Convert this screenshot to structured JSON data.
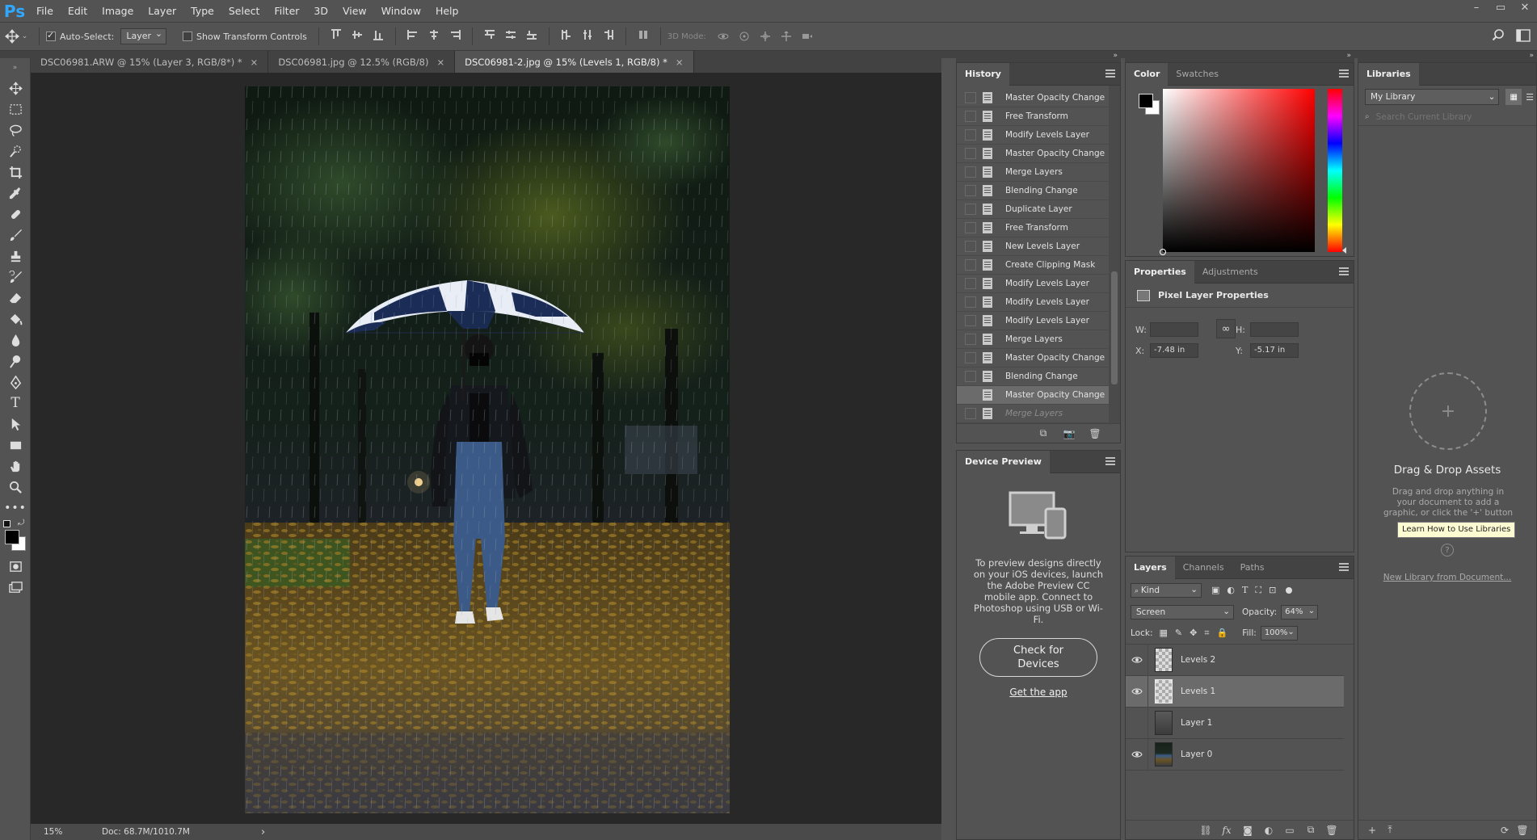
{
  "app": {
    "logo": "Ps"
  },
  "menu": [
    "File",
    "Edit",
    "Image",
    "Layer",
    "Type",
    "Select",
    "Filter",
    "3D",
    "View",
    "Window",
    "Help"
  ],
  "window_controls": [
    "–",
    "▭",
    "✕"
  ],
  "options_bar": {
    "auto_select_label": "Auto-Select:",
    "auto_select_checked": true,
    "auto_select_value": "Layer",
    "show_transform_label": "Show Transform Controls",
    "mode_3d_label": "3D Mode:"
  },
  "doc_tabs": [
    {
      "title": "DSC06981.ARW @ 15% (Layer 3, RGB/8*) *",
      "active": false
    },
    {
      "title": "DSC06981.jpg @ 12.5% (RGB/8)",
      "active": false
    },
    {
      "title": "DSC06981-2.jpg @ 15% (Levels 1, RGB/8) *",
      "active": true
    }
  ],
  "status": {
    "zoom": "15%",
    "doc": "Doc: 68.7M/1010.7M",
    "arrow": "›"
  },
  "history": {
    "title": "History",
    "items": [
      {
        "label": "Master Opacity Change",
        "state": "normal"
      },
      {
        "label": "Free Transform",
        "state": "normal"
      },
      {
        "label": "Modify Levels Layer",
        "state": "normal"
      },
      {
        "label": "Master Opacity Change",
        "state": "normal"
      },
      {
        "label": "Merge Layers",
        "state": "normal"
      },
      {
        "label": "Blending Change",
        "state": "normal"
      },
      {
        "label": "Duplicate Layer",
        "state": "normal"
      },
      {
        "label": "Free Transform",
        "state": "normal"
      },
      {
        "label": "New Levels Layer",
        "state": "normal"
      },
      {
        "label": "Create Clipping Mask",
        "state": "normal"
      },
      {
        "label": "Modify Levels Layer",
        "state": "normal"
      },
      {
        "label": "Modify Levels Layer",
        "state": "normal"
      },
      {
        "label": "Modify Levels Layer",
        "state": "normal"
      },
      {
        "label": "Merge Layers",
        "state": "normal"
      },
      {
        "label": "Master Opacity Change",
        "state": "normal"
      },
      {
        "label": "Blending Change",
        "state": "normal"
      },
      {
        "label": "Master Opacity Change",
        "state": "selected"
      },
      {
        "label": "Merge Layers",
        "state": "dim"
      }
    ]
  },
  "device_preview": {
    "title": "Device Preview",
    "message": "To preview designs directly on your iOS devices, launch the Adobe Preview CC mobile app. Connect to Photoshop using USB or Wi-Fi.",
    "check_button": "Check for Devices",
    "get_app_link": "Get the app"
  },
  "color": {
    "tabs": [
      "Color",
      "Swatches"
    ],
    "hue_color": "#ff0000",
    "fg": "#000000",
    "bg": "#ffffff"
  },
  "properties": {
    "tabs": [
      "Properties",
      "Adjustments"
    ],
    "heading": "Pixel Layer Properties",
    "w_label": "W:",
    "w_value": "",
    "h_label": "H:",
    "h_value": "",
    "x_label": "X:",
    "x_value": "-7.48 in",
    "y_label": "Y:",
    "y_value": "-5.17 in",
    "link_icon": "∞"
  },
  "layers": {
    "tabs": [
      "Layers",
      "Channels",
      "Paths"
    ],
    "kind": "Kind",
    "filter_icons": [
      "▣",
      "◐",
      "T",
      "⛶",
      "⊡"
    ],
    "blend_mode": "Screen",
    "opacity_label": "Opacity:",
    "opacity_value": "64%",
    "lock_label": "Lock:",
    "fill_label": "Fill:",
    "fill_value": "100%",
    "items": [
      {
        "name": "Levels 2",
        "visible": true,
        "selected": false,
        "thumb": "checker"
      },
      {
        "name": "Levels 1",
        "visible": true,
        "selected": true,
        "thumb": "checker"
      },
      {
        "name": "Layer 1",
        "visible": false,
        "selected": false,
        "thumb": "gray"
      },
      {
        "name": "Layer 0",
        "visible": true,
        "selected": false,
        "thumb": "photo"
      }
    ],
    "bottom_icons": [
      "⛓",
      "fx",
      "◙",
      "◐",
      "▭",
      "⧉",
      "🗑"
    ]
  },
  "libraries": {
    "title": "Libraries",
    "library_select": "My Library",
    "search_placeholder": "Search Current Library",
    "drag_title": "Drag & Drop Assets",
    "drag_desc": "Drag and drop anything in your document to add a graphic, or click the '+' button below to add colors,",
    "tooltip": "Learn How to Use Libraries",
    "help_icon": "?",
    "new_link": "New Library from Document...",
    "plus": "+"
  }
}
